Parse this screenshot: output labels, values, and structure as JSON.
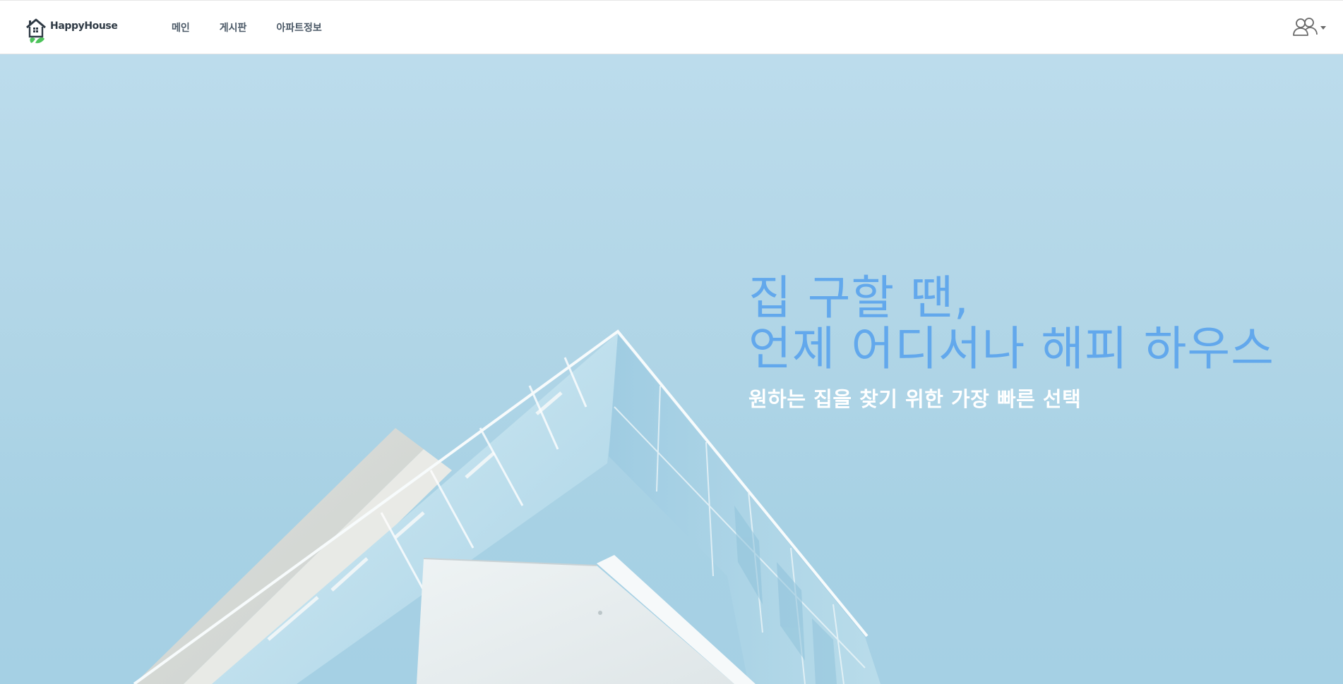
{
  "header": {
    "brand_name": "HappyHouse",
    "nav": [
      {
        "label": "메인"
      },
      {
        "label": "게시판"
      },
      {
        "label": "아파트정보"
      }
    ],
    "user_menu_icon": "users-icon"
  },
  "hero": {
    "title_line1": "집 구할 땐,",
    "title_line2": "언제 어디서나 해피 하우스",
    "subtitle": "원하는 집을 찾기 위한 가장 빠른 선택",
    "background_image": "modern-glass-building-from-below"
  },
  "colors": {
    "title_accent": "#62a8ec",
    "sky": "#b4d8ea",
    "nav_text": "#4a5866",
    "logo_green": "#4cc35a"
  }
}
